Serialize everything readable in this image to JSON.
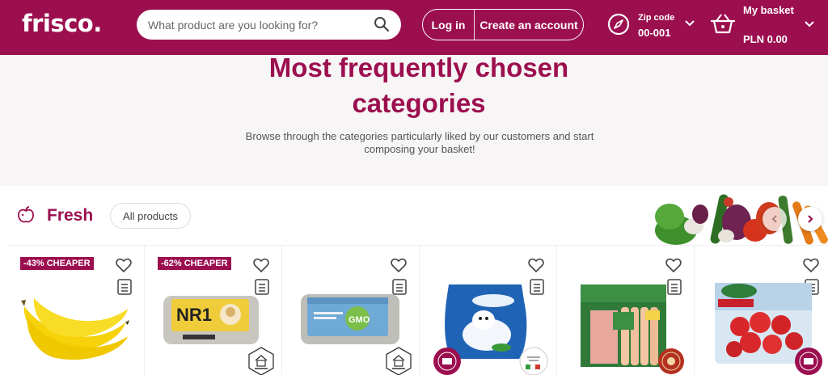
{
  "header": {
    "logo": "frisco.",
    "search_placeholder": "What product are you looking for?",
    "login_label": "Log in",
    "create_account_label": "Create an account",
    "zip_label": "Zip code",
    "zip_value": "00-001",
    "basket_label": "My basket",
    "basket_value": "PLN 0.00"
  },
  "hero": {
    "title_line1": "Most frequently chosen",
    "title_line2": "categories",
    "subtitle_line1": "Browse through the categories particularly liked by our customers and start",
    "subtitle_line2": "composing your basket!"
  },
  "fresh": {
    "title": "Fresh",
    "all_products_label": "All products",
    "products": [
      {
        "badge": "-43% CHEAPER",
        "image": "bananas"
      },
      {
        "badge": "-62% CHEAPER",
        "image": "eggs-nr1"
      },
      {
        "badge": "",
        "image": "eggs-gmo"
      },
      {
        "badge": "",
        "image": "mozzarella"
      },
      {
        "badge": "",
        "image": "sausages"
      },
      {
        "badge": "",
        "image": "strawberries"
      }
    ]
  },
  "colors": {
    "brand": "#9c0f4f",
    "background": "#f7f5f5"
  }
}
